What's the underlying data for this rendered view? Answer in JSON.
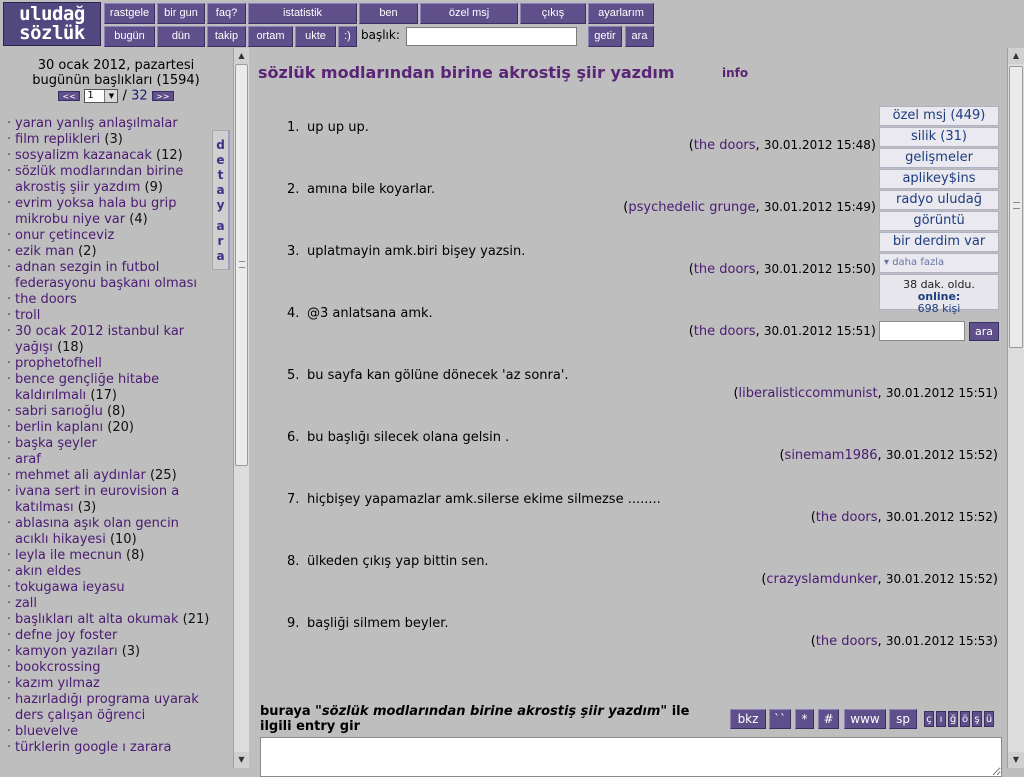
{
  "logo": {
    "line1": "uludağ",
    "line2": "sözlük"
  },
  "nav_row1": [
    "rastgele",
    "bir gun",
    "faq?",
    "istatistik",
    "ben",
    "özel msj",
    "çıkış",
    "ayarlarım"
  ],
  "nav_row2": [
    "bugün",
    "dün",
    "takip",
    "ortam",
    "ukte",
    ":)"
  ],
  "search": {
    "label": "başlık:",
    "value": "",
    "getir": "getir",
    "ara": "ara"
  },
  "left": {
    "date": "30 ocak 2012, pazartesi",
    "today": "bugünün başlıkları (1594)",
    "pager": {
      "prev": "<<",
      "page": "1",
      "total": "32",
      "next": ">>",
      "sep": "/"
    },
    "side_tab": [
      "d",
      "e",
      "t",
      "a",
      "y",
      "",
      "a",
      "r",
      "a"
    ],
    "topics": [
      {
        "title": "yaran yanlış anlaşılmalar",
        "count": ""
      },
      {
        "title": "film replikleri",
        "count": "(3)"
      },
      {
        "title": "sosyalizm kazanacak",
        "count": "(12)"
      },
      {
        "title": "sözlük modlarından birine akrostiş şiir yazdım",
        "count": "(9)"
      },
      {
        "title": "evrim yoksa hala bu grip mikrobu niye var",
        "count": "(4)"
      },
      {
        "title": "onur çetinceviz",
        "count": ""
      },
      {
        "title": "ezik man",
        "count": "(2)"
      },
      {
        "title": "adnan sezgin in futbol federasyonu başkanı olması",
        "count": ""
      },
      {
        "title": "the doors",
        "count": ""
      },
      {
        "title": "troll",
        "count": ""
      },
      {
        "title": "30 ocak 2012 istanbul kar yağışı",
        "count": "(18)"
      },
      {
        "title": "prophetofhell",
        "count": ""
      },
      {
        "title": "bence gençliğe hitabe kaldırılmalı",
        "count": "(17)"
      },
      {
        "title": "sabri sarıoğlu",
        "count": "(8)"
      },
      {
        "title": "berlin kaplanı",
        "count": "(20)"
      },
      {
        "title": "başka şeyler",
        "count": ""
      },
      {
        "title": "araf",
        "count": ""
      },
      {
        "title": "mehmet ali aydınlar",
        "count": "(25)"
      },
      {
        "title": "ivana sert in eurovision a katılması",
        "count": "(3)"
      },
      {
        "title": "ablasına aşık olan gencin acıklı hikayesi",
        "count": "(10)"
      },
      {
        "title": "leyla ile mecnun",
        "count": "(8)"
      },
      {
        "title": "akın eldes",
        "count": ""
      },
      {
        "title": "tokugawa ieyasu",
        "count": ""
      },
      {
        "title": "zall",
        "count": ""
      },
      {
        "title": "başlıkları alt alta okumak",
        "count": "(21)"
      },
      {
        "title": "defne joy foster",
        "count": ""
      },
      {
        "title": "kamyon yazıları",
        "count": "(3)"
      },
      {
        "title": "bookcrossing",
        "count": ""
      },
      {
        "title": "kazım yılmaz",
        "count": ""
      },
      {
        "title": "hazırladığı programa uyarak ders çalışan öğrenci",
        "count": ""
      },
      {
        "title": "bluevelve",
        "count": ""
      },
      {
        "title": "türklerin google ı zarara",
        "count": ""
      }
    ]
  },
  "topic": {
    "title": "sözlük modlarından birine akrostiş şiir yazdım",
    "info": "info"
  },
  "entries": [
    {
      "n": "1.",
      "text": "up up up.",
      "author": "the doors",
      "time": "30.01.2012 15:48"
    },
    {
      "n": "2.",
      "text": "amına bile koyarlar.",
      "author": "psychedelic grunge",
      "time": "30.01.2012 15:49"
    },
    {
      "n": "3.",
      "text": "uplatmayin amk.biri bişey yazsin.",
      "author": "the doors",
      "time": "30.01.2012 15:50"
    },
    {
      "n": "4.",
      "text": "@3 anlatsana amk.",
      "author": "the doors",
      "time": "30.01.2012 15:51"
    },
    {
      "n": "5.",
      "text": "bu sayfa kan gölüne dönecek 'az sonra'.",
      "author": "liberalisticcommunist",
      "time": "30.01.2012 15:51"
    },
    {
      "n": "6.",
      "text": "bu başlığı silecek olana gelsin .",
      "author": "sinemam1986",
      "time": "30.01.2012 15:52"
    },
    {
      "n": "7.",
      "text": "hiçbişey yapamazlar amk.silerse ekime silmezse ........",
      "author": "the doors",
      "time": "30.01.2012 15:52"
    },
    {
      "n": "8.",
      "text": "ülkeden çıkış yap bittin sen.",
      "author": "crazyslamdunker",
      "time": "30.01.2012 15:52"
    },
    {
      "n": "9.",
      "text": "başliği silmem beyler.",
      "author": "the doors",
      "time": "30.01.2012 15:53"
    }
  ],
  "rightbox": {
    "items": [
      "özel msj (449)",
      "silik (31)",
      "gelişmeler",
      "aplikey$ins",
      "radyo uludağ",
      "görüntü",
      "bir derdim var"
    ],
    "more": "▾ daha fazla",
    "online_ago": "38 dak. oldu.",
    "online_label": "online:",
    "online_count": "698 kişi",
    "search_button": "ara"
  },
  "composer": {
    "prefix": "buraya",
    "quoted": "\"sözlük modlarından birine akrostiş şiir yazdım\"",
    "suffix": "ile ilgili entry gir",
    "buttons": [
      "bkz",
      "``",
      "*",
      "#",
      "www",
      "sp"
    ],
    "chars": [
      "ç",
      "ı",
      "ğ",
      "ö",
      "ş",
      "ü"
    ]
  },
  "colors": {
    "accent": "#5f4f8a",
    "title": "#5a2477",
    "link": "#4b1a72",
    "box_text": "#1d3d7f",
    "background": "#bebebe"
  }
}
